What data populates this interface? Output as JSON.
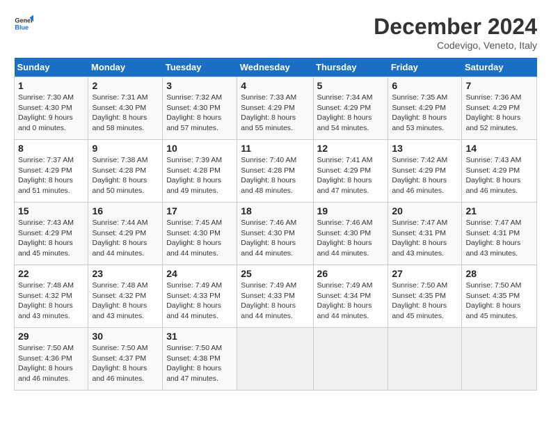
{
  "logo": {
    "text_general": "General",
    "text_blue": "Blue"
  },
  "header": {
    "month": "December 2024",
    "location": "Codevigo, Veneto, Italy"
  },
  "weekdays": [
    "Sunday",
    "Monday",
    "Tuesday",
    "Wednesday",
    "Thursday",
    "Friday",
    "Saturday"
  ],
  "weeks": [
    [
      {
        "day": "1",
        "sunrise": "Sunrise: 7:30 AM",
        "sunset": "Sunset: 4:30 PM",
        "daylight": "Daylight: 9 hours and 0 minutes."
      },
      {
        "day": "2",
        "sunrise": "Sunrise: 7:31 AM",
        "sunset": "Sunset: 4:30 PM",
        "daylight": "Daylight: 8 hours and 58 minutes."
      },
      {
        "day": "3",
        "sunrise": "Sunrise: 7:32 AM",
        "sunset": "Sunset: 4:30 PM",
        "daylight": "Daylight: 8 hours and 57 minutes."
      },
      {
        "day": "4",
        "sunrise": "Sunrise: 7:33 AM",
        "sunset": "Sunset: 4:29 PM",
        "daylight": "Daylight: 8 hours and 55 minutes."
      },
      {
        "day": "5",
        "sunrise": "Sunrise: 7:34 AM",
        "sunset": "Sunset: 4:29 PM",
        "daylight": "Daylight: 8 hours and 54 minutes."
      },
      {
        "day": "6",
        "sunrise": "Sunrise: 7:35 AM",
        "sunset": "Sunset: 4:29 PM",
        "daylight": "Daylight: 8 hours and 53 minutes."
      },
      {
        "day": "7",
        "sunrise": "Sunrise: 7:36 AM",
        "sunset": "Sunset: 4:29 PM",
        "daylight": "Daylight: 8 hours and 52 minutes."
      }
    ],
    [
      {
        "day": "8",
        "sunrise": "Sunrise: 7:37 AM",
        "sunset": "Sunset: 4:29 PM",
        "daylight": "Daylight: 8 hours and 51 minutes."
      },
      {
        "day": "9",
        "sunrise": "Sunrise: 7:38 AM",
        "sunset": "Sunset: 4:28 PM",
        "daylight": "Daylight: 8 hours and 50 minutes."
      },
      {
        "day": "10",
        "sunrise": "Sunrise: 7:39 AM",
        "sunset": "Sunset: 4:28 PM",
        "daylight": "Daylight: 8 hours and 49 minutes."
      },
      {
        "day": "11",
        "sunrise": "Sunrise: 7:40 AM",
        "sunset": "Sunset: 4:28 PM",
        "daylight": "Daylight: 8 hours and 48 minutes."
      },
      {
        "day": "12",
        "sunrise": "Sunrise: 7:41 AM",
        "sunset": "Sunset: 4:29 PM",
        "daylight": "Daylight: 8 hours and 47 minutes."
      },
      {
        "day": "13",
        "sunrise": "Sunrise: 7:42 AM",
        "sunset": "Sunset: 4:29 PM",
        "daylight": "Daylight: 8 hours and 46 minutes."
      },
      {
        "day": "14",
        "sunrise": "Sunrise: 7:43 AM",
        "sunset": "Sunset: 4:29 PM",
        "daylight": "Daylight: 8 hours and 46 minutes."
      }
    ],
    [
      {
        "day": "15",
        "sunrise": "Sunrise: 7:43 AM",
        "sunset": "Sunset: 4:29 PM",
        "daylight": "Daylight: 8 hours and 45 minutes."
      },
      {
        "day": "16",
        "sunrise": "Sunrise: 7:44 AM",
        "sunset": "Sunset: 4:29 PM",
        "daylight": "Daylight: 8 hours and 44 minutes."
      },
      {
        "day": "17",
        "sunrise": "Sunrise: 7:45 AM",
        "sunset": "Sunset: 4:30 PM",
        "daylight": "Daylight: 8 hours and 44 minutes."
      },
      {
        "day": "18",
        "sunrise": "Sunrise: 7:46 AM",
        "sunset": "Sunset: 4:30 PM",
        "daylight": "Daylight: 8 hours and 44 minutes."
      },
      {
        "day": "19",
        "sunrise": "Sunrise: 7:46 AM",
        "sunset": "Sunset: 4:30 PM",
        "daylight": "Daylight: 8 hours and 44 minutes."
      },
      {
        "day": "20",
        "sunrise": "Sunrise: 7:47 AM",
        "sunset": "Sunset: 4:31 PM",
        "daylight": "Daylight: 8 hours and 43 minutes."
      },
      {
        "day": "21",
        "sunrise": "Sunrise: 7:47 AM",
        "sunset": "Sunset: 4:31 PM",
        "daylight": "Daylight: 8 hours and 43 minutes."
      }
    ],
    [
      {
        "day": "22",
        "sunrise": "Sunrise: 7:48 AM",
        "sunset": "Sunset: 4:32 PM",
        "daylight": "Daylight: 8 hours and 43 minutes."
      },
      {
        "day": "23",
        "sunrise": "Sunrise: 7:48 AM",
        "sunset": "Sunset: 4:32 PM",
        "daylight": "Daylight: 8 hours and 43 minutes."
      },
      {
        "day": "24",
        "sunrise": "Sunrise: 7:49 AM",
        "sunset": "Sunset: 4:33 PM",
        "daylight": "Daylight: 8 hours and 44 minutes."
      },
      {
        "day": "25",
        "sunrise": "Sunrise: 7:49 AM",
        "sunset": "Sunset: 4:33 PM",
        "daylight": "Daylight: 8 hours and 44 minutes."
      },
      {
        "day": "26",
        "sunrise": "Sunrise: 7:49 AM",
        "sunset": "Sunset: 4:34 PM",
        "daylight": "Daylight: 8 hours and 44 minutes."
      },
      {
        "day": "27",
        "sunrise": "Sunrise: 7:50 AM",
        "sunset": "Sunset: 4:35 PM",
        "daylight": "Daylight: 8 hours and 45 minutes."
      },
      {
        "day": "28",
        "sunrise": "Sunrise: 7:50 AM",
        "sunset": "Sunset: 4:35 PM",
        "daylight": "Daylight: 8 hours and 45 minutes."
      }
    ],
    [
      {
        "day": "29",
        "sunrise": "Sunrise: 7:50 AM",
        "sunset": "Sunset: 4:36 PM",
        "daylight": "Daylight: 8 hours and 46 minutes."
      },
      {
        "day": "30",
        "sunrise": "Sunrise: 7:50 AM",
        "sunset": "Sunset: 4:37 PM",
        "daylight": "Daylight: 8 hours and 46 minutes."
      },
      {
        "day": "31",
        "sunrise": "Sunrise: 7:50 AM",
        "sunset": "Sunset: 4:38 PM",
        "daylight": "Daylight: 8 hours and 47 minutes."
      },
      null,
      null,
      null,
      null
    ]
  ]
}
